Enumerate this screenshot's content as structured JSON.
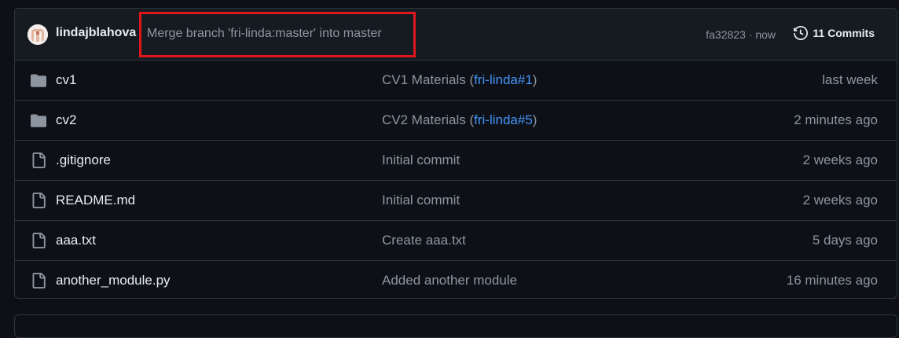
{
  "commit": {
    "author": "lindajblahova",
    "message": "Merge branch 'fri-linda:master' into master",
    "sha": "fa32823",
    "separator": " · ",
    "time": "now",
    "commits_label": "11 Commits"
  },
  "files": [
    {
      "type": "folder",
      "name": "cv1",
      "message_prefix": "CV1 Materials (",
      "message_link": "fri-linda#1",
      "message_suffix": ")",
      "age": "last week"
    },
    {
      "type": "folder",
      "name": "cv2",
      "message_prefix": "CV2 Materials (",
      "message_link": "fri-linda#5",
      "message_suffix": ")",
      "age": "2 minutes ago"
    },
    {
      "type": "file",
      "name": ".gitignore",
      "message_prefix": "Initial commit",
      "message_link": "",
      "message_suffix": "",
      "age": "2 weeks ago"
    },
    {
      "type": "file",
      "name": "README.md",
      "message_prefix": "Initial commit",
      "message_link": "",
      "message_suffix": "",
      "age": "2 weeks ago"
    },
    {
      "type": "file",
      "name": "aaa.txt",
      "message_prefix": "Create aaa.txt",
      "message_link": "",
      "message_suffix": "",
      "age": "5 days ago"
    },
    {
      "type": "file",
      "name": "another_module.py",
      "message_prefix": "Added another module",
      "message_link": "",
      "message_suffix": "",
      "age": "16 minutes ago"
    }
  ],
  "colors": {
    "background": "#0d1117",
    "header_bg": "#161b22",
    "border": "#30363d",
    "link": "#4493f8",
    "muted": "#8d96a0",
    "highlight": "#e0161d"
  }
}
